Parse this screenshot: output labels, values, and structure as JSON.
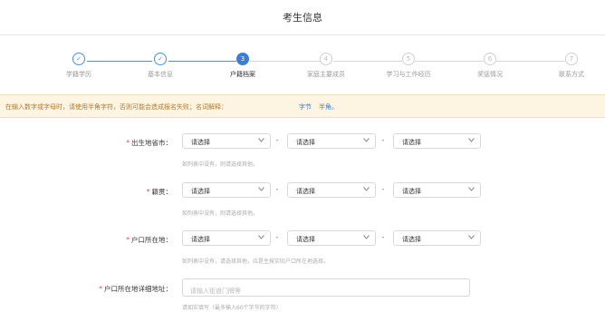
{
  "header": {
    "title": "考生信息"
  },
  "steps": [
    {
      "label": "学籍学历",
      "num": "✓",
      "state": "done"
    },
    {
      "label": "基本信息",
      "num": "✓",
      "state": "done"
    },
    {
      "label": "户籍档案",
      "num": "3",
      "state": "active"
    },
    {
      "label": "家庭主要成员",
      "num": "4",
      "state": "todo"
    },
    {
      "label": "学习与工作经历",
      "num": "5",
      "state": "todo"
    },
    {
      "label": "奖惩情况",
      "num": "6",
      "state": "todo"
    },
    {
      "label": "联系方式",
      "num": "7",
      "state": "todo"
    }
  ],
  "notice": {
    "text": "在输入数字或字母时，请使用半角字符，否则可能会造成报名失败；名词解释：",
    "link1": "字节",
    "link2": "半角。"
  },
  "form": {
    "birthplace": {
      "label": "出生地省市：",
      "selects": [
        "请选择",
        "请选择",
        "请选择"
      ],
      "hint": "如列表中没有，则请选择其他。"
    },
    "native": {
      "label": "籍贯：",
      "selects": [
        "请选择",
        "请选择",
        "请选择"
      ],
      "hint": "如列表中没有，则请选择其他。"
    },
    "hukou": {
      "label": "户口所在地：",
      "selects": [
        "请选择",
        "请选择",
        "请选择"
      ],
      "hint": "如列表中没有，请选择其他，应是生按实际户口所在地选择。"
    },
    "address": {
      "label": "户口所在地详细地址：",
      "placeholder": "请输入街道门牌等",
      "hint": "请如实填写（最多输入60个字节的字符）"
    }
  },
  "colors": {
    "accent": "#3a7fd5",
    "required": "#e24a4a",
    "notice_bg": "#fdf4e2"
  }
}
